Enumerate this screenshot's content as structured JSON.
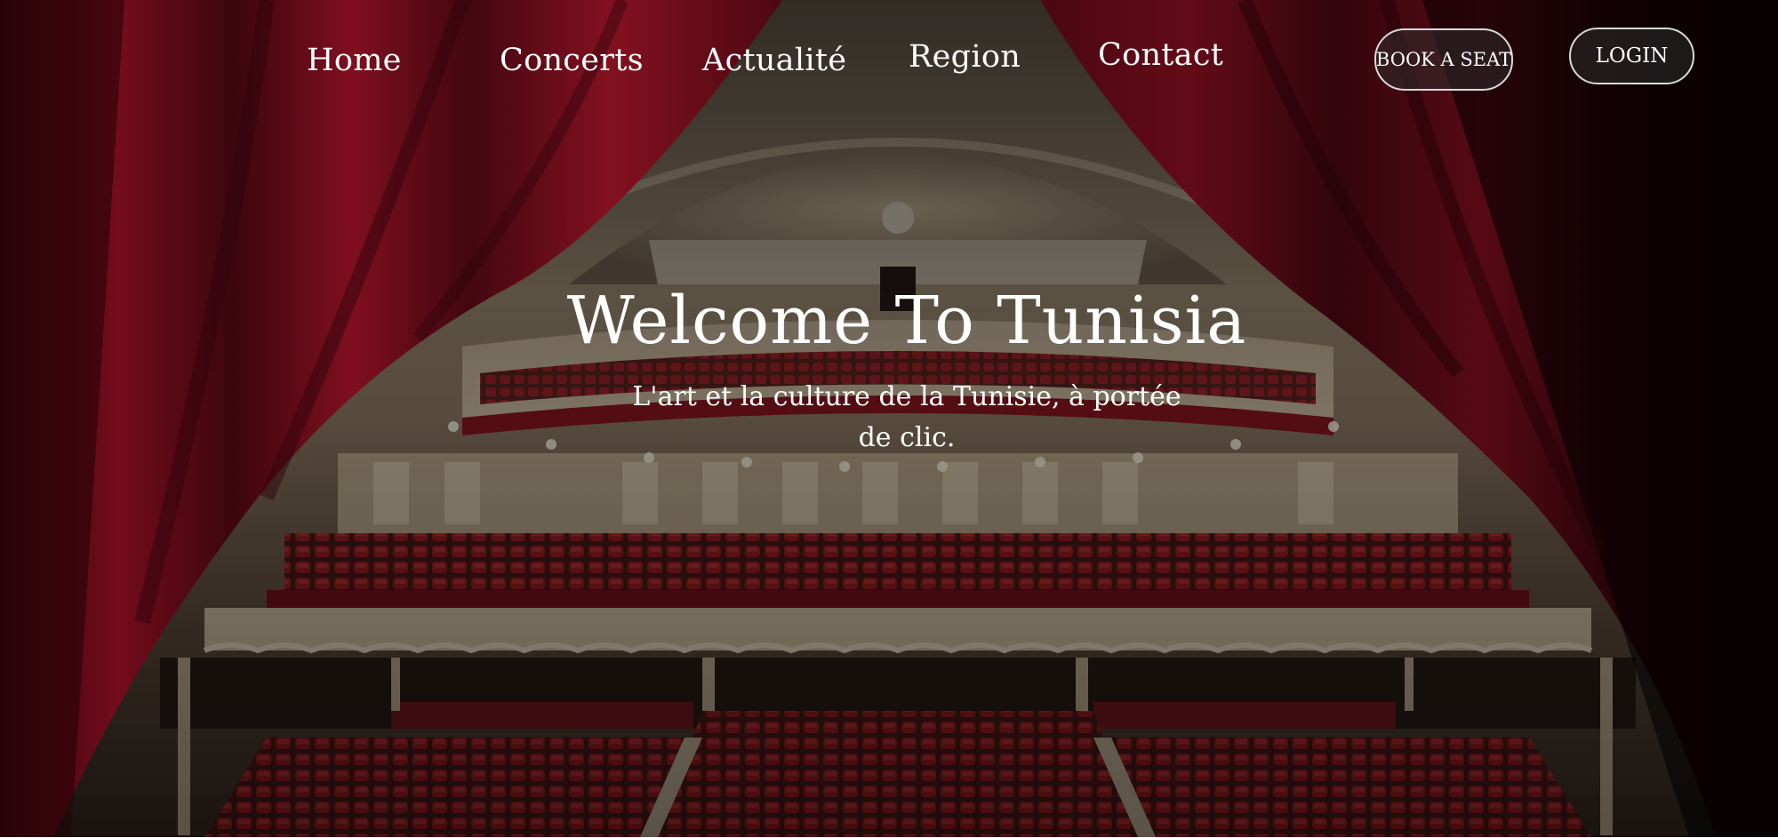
{
  "nav": {
    "items": [
      {
        "label": "Home"
      },
      {
        "label": "Concerts"
      },
      {
        "label": "Actualité"
      },
      {
        "label": "Region"
      },
      {
        "label": "Contact"
      }
    ],
    "book_label": "BOOK A SEAT",
    "login_label": "LOGIN"
  },
  "hero": {
    "title": "Welcome To Tunisia",
    "subtitle": "L'art et la culture de la Tunisie, à portée de clic."
  },
  "colors": {
    "curtain": "#7a0c1c",
    "seat": "#8c1b22",
    "balcony": "#c8b79a",
    "overlay": "#000000"
  }
}
